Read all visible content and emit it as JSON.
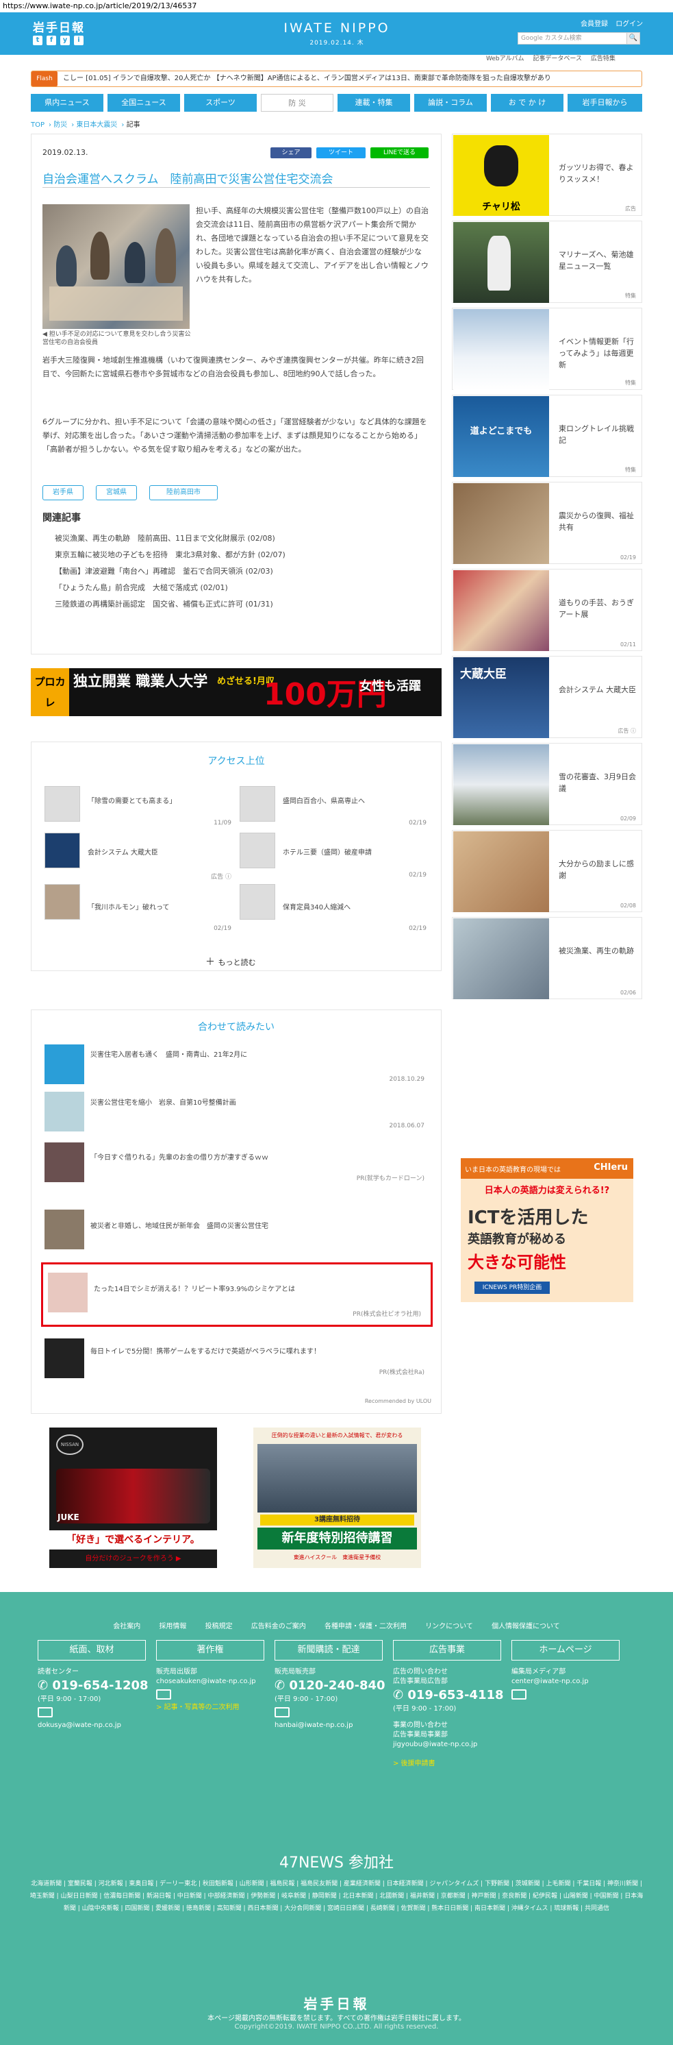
{
  "url": "https://www.iwate-np.co.jp/article/2019/2/13/46537",
  "header": {
    "logo": "岩手日報",
    "brand": "IWATE NIPPO",
    "date": "2019.02.14. 木",
    "links": [
      "会員登録",
      "ログイン"
    ],
    "search_placeholder": "Google カスタム検索",
    "search_button": "🔍",
    "subnav": [
      "Webアルバム",
      "記事データベース",
      "広告特集"
    ],
    "sns": [
      "t",
      "f",
      "y",
      "i"
    ]
  },
  "ticker": {
    "label": "Flash",
    "text": "こしー  [01.05] イランで自爆攻撃、20人死亡か  【ナヘネウ新聞】AP通信によると、イラン国営メディアは13日、南東部で革命防衛隊を狙った自爆攻撃があり"
  },
  "nav": [
    "県内ニュース",
    "全国ニュース",
    "スポーツ",
    "防 災",
    "連載・特集",
    "論説・コラム",
    "お で か け",
    "岩手日報から"
  ],
  "nav_active": "防 災",
  "breadcrumb": [
    "TOP",
    "防災",
    "東日本大震災",
    "記事"
  ],
  "article": {
    "date": "2019.02.13.",
    "share": [
      "シェア",
      "ツイート",
      "LINEで送る"
    ],
    "title": "自治会運営へスクラム　陸前高田で災害公営住宅交流会",
    "caption": "◀ 担い手不足の対応について意見を交わし合う災害公営住宅の自治会役員",
    "p1": "担い手、高経年の大規模災害公営住宅（整備戸数100戸以上）の自治会交流会は11日、陸前高田市の県営栃ケ沢アパート集会所で開かれ、各団地で課題となっている自治会の担い手不足について意見を交わした。災害公営住宅は高齢化率が高く、自治会運営の経験が少ない役員も多い。県域を越えて交流し、アイデアを出し合い情報とノウハウを共有した。",
    "p2": "岩手大三陸復興・地域創生推進機構（いわて復興連携センター、みやぎ連携復興センターが共催。昨年に続き2回目で、今回新たに宮城県石巻市や多賀城市などの自治会役員も参加し、8団地約90人で話し合った。",
    "p3": "6グループに分かれ、担い手不足について「会議の意味や関心の低さ」「運営経験者が少ない」など具体的な課題を挙げ、対応策を出し合った。「あいさつ運動や清掃活動の参加率を上げ、まずは顔見知りになることから始める」「高齢者が担うしかない。やる気を促す取り組みを考える」などの案が出た。",
    "tags": [
      "岩手県",
      "宮城県",
      "陸前高田市"
    ],
    "related_heading": "関連記事",
    "related": [
      "被災漁業、再生の軌跡　陸前高田、11日まで文化財展示 (02/08)",
      "東京五輪に被災地の子どもを招待　東北3県対象、都が方針 (02/07)",
      "【動画】津波避難「南台へ」再確認　釜石で合同天領浜 (02/03)",
      "「ひょうたん島」前合完成　大槌で落成式 (02/01)",
      "三陸鉄道の再構築計画認定　国交省、補償も正式に許可 (01/31)"
    ]
  },
  "ad1": {
    "y": "プロカレ",
    "m": "独立開業 職業人大学",
    "r": "めざせる!月収",
    "n": "100万円",
    "e": "女性も活躍"
  },
  "access": {
    "heading": "アクセス上位",
    "items": [
      {
        "t": "「除雪の需要とても高まる」",
        "d": "11/09"
      },
      {
        "t": "盛岡白百合小、県高専止へ",
        "d": "02/19"
      },
      {
        "t": "会計システム 大蔵大臣",
        "d": "広告 ⓘ"
      },
      {
        "t": "ホテル三要（盛岡）破産申請",
        "d": "02/19"
      },
      {
        "t": "「我川ホルモン」破れって",
        "d": "02/19"
      },
      {
        "t": "保育定員340人縮減へ",
        "d": "02/19"
      }
    ],
    "more": "もっと読む"
  },
  "recommend": {
    "heading": "合わせて読みたい",
    "items": [
      {
        "t": "災害住宅入居者も通く　盛岡・南青山、21年2月に",
        "m": "2018.10.29"
      },
      {
        "t": "災害公営住宅を縮小　岩泉、自第10号整備計画",
        "m": "2018.06.07"
      },
      {
        "t": "「今日すぐ借りれる」先輩のお金の借り方が凄すぎるｗｗ",
        "m": "PR(就学もカードローン)"
      },
      {
        "t": "被災者と非婚し、地域住民が新年会　盛岡の災害公営住宅",
        "m": ""
      },
      {
        "t": "たった14日でシミが消える！？リピート率93.9%のシミケアとは",
        "m": "PR(株式会社ビオラ社用)"
      },
      {
        "t": "毎日トイレで5分間！携帯ゲームをするだけで英語がペラペラに喋れます！",
        "m": "PR(株式会社Ra)"
      }
    ],
    "powered": "Recommended by ULOU"
  },
  "ad2": {
    "brand": "NISSAN",
    "car": "JUKE",
    "copy": "「好き」で選べるインテリア。",
    "sub": "自分だけのジュークを作ろう ▶"
  },
  "ad3": {
    "top": "圧倒的な授業の違いと最新の入試情報で、君が変わる",
    "band": "3講座無料招待",
    "big": "新年度特別招待講習",
    "foot": "東進ハイスクール　東進衛星予備校"
  },
  "sidebar": [
    {
      "t": "ガッツリお得で、春よりスッスメ！",
      "d": "広告",
      "img": "cycle",
      "label": "チャリ松"
    },
    {
      "t": "マリナーズへ、菊池雄星ニュース一覧",
      "d": "特集",
      "img": "baseball"
    },
    {
      "t": "イベント情報更新「行ってみよう」は毎週更新",
      "d": "特集",
      "img": "snow"
    },
    {
      "t": "東ロングトレイル挑戦記",
      "d": "特集",
      "img": "trail",
      "label": "道よどこまでも"
    },
    {
      "t": "震災からの復興、福祉共有",
      "d": "02/19",
      "img": "meeting"
    },
    {
      "t": "道もりの手芸、おうぎアート展",
      "d": "02/11",
      "img": "craft"
    },
    {
      "t": "会計システム 大蔵大臣",
      "d": "広告 ⓘ",
      "img": "ad",
      "label": "大蔵大臣"
    },
    {
      "t": "雪の花審査、3月9日会議",
      "d": "02/09",
      "img": "mountain"
    },
    {
      "t": "大分からの励ましに感謝",
      "d": "02/08",
      "img": "kids"
    },
    {
      "t": "被災漁業、再生の軌跡",
      "d": "02/06",
      "img": "lab"
    }
  ],
  "side_ad": {
    "top": "いま日本の英語教育の現場では",
    "brand": "CHIeru",
    "q": "日本人の英語力は変えられる!?",
    "h1": "ICTを活用した",
    "h2": "英語教育が秘める",
    "h3": "大きな可能性",
    "foot": "ICNEWS PR特別企画"
  },
  "footer": {
    "links": [
      "会社案内",
      "採用情報",
      "投稿規定",
      "広告料金のご案内",
      "各種申請・保護・二次利用",
      "リンクについて",
      "個人情報保護について"
    ],
    "cats": [
      "紙面、取材",
      "著作権",
      "新聞購読・配達",
      "広告事業",
      "ホームページ"
    ],
    "cols": [
      {
        "l1": "読者センター",
        "tel": "019-654-1208",
        "hours": "(平日 9:00 - 17:00)",
        "mail": "dokusya@iwate-np.co.jp"
      },
      {
        "l1": "販売局出版部",
        "mail": "choseakuken@iwate-np.co.jp",
        "extra": "> 記事・写真等の二次利用"
      },
      {
        "l1": "販売局販売部",
        "tel": "0120-240-840",
        "hours": "(平日 9:00 - 17:00)",
        "mail": "hanbai@iwate-np.co.jp"
      },
      {
        "l1": "広告の問い合わせ",
        "l2": "広告事業局広告部",
        "tel": "019-653-4118",
        "hours": "(平日 9:00 - 17:00)",
        "l3": "事業の問い合わせ",
        "l4": "広告事業局事業部",
        "mail": "jigyoubu@iwate-np.co.jp",
        "extra": "> 後援申請書"
      },
      {
        "l1": "編集局メディア部",
        "mail": "center@iwate-np.co.jp"
      }
    ],
    "n47": "47NEWS 参加社",
    "papers": "北海道新聞 | 室蘭民報 | 河北新報 | 東奥日報 | デーリー東北 | 秋田魁新報 | 山形新聞 | 福島民報 | 福島民友新聞 | 産業経済新聞 | 日本経済新聞 | ジャパンタイムズ | 下野新聞 | 茨城新聞 | 上毛新聞 | 千葉日報 | 神奈川新聞 | 埼玉新聞 | 山梨日日新聞 | 信濃毎日新聞 | 新潟日報 | 中日新聞 | 中部経済新聞 | 伊勢新聞 | 岐阜新聞 | 静岡新聞 | 北日本新聞 | 北國新聞 | 福井新聞 | 京都新聞 | 神戸新聞 | 奈良新聞 | 紀伊民報 | 山陽新聞 | 中国新聞 | 日本海新聞 | 山陰中央新報 | 四国新聞 | 愛媛新聞 | 徳島新聞 | 高知新聞 | 西日本新聞 | 大分合同新聞 | 宮崎日日新聞 | 長崎新聞 | 佐賀新聞 | 熊本日日新聞 | 南日本新聞 | 沖縄タイムス | 琉球新報 | 共同通信",
    "logo": "岩手日報",
    "note": "本ページ掲載内容の無断転載を禁じます。すべての著作権は岩手日報社に属します。",
    "copy": "Copyright©2019. IWATE NIPPO CO.,LTD. All rights reserved."
  }
}
